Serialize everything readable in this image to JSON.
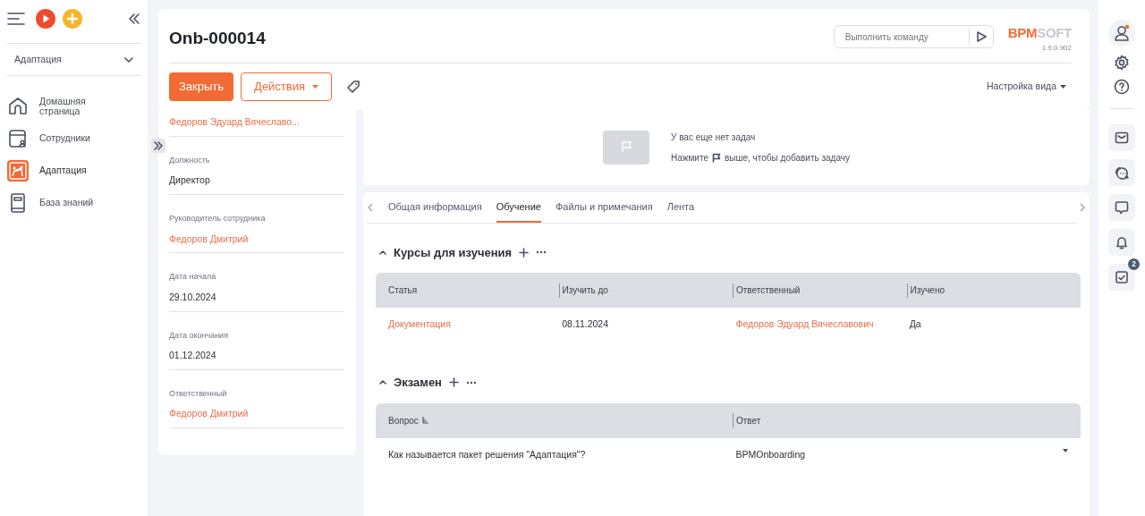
{
  "sidebar": {
    "workspace": "Адаптация",
    "items": [
      {
        "label": "Домашняя страница",
        "selected": false
      },
      {
        "label": "Сотрудники",
        "selected": false
      },
      {
        "label": "Адаптация",
        "selected": true
      },
      {
        "label": "База знаний",
        "selected": false
      }
    ]
  },
  "header": {
    "title": "Onb-000014",
    "command_placeholder": "Выполнить команду",
    "logo": {
      "accent": "BPM",
      "rest": "SOFT"
    },
    "version": "1.9.0.902"
  },
  "actions": {
    "close": "Закрыть",
    "actions": "Действия",
    "view_settings": "Настройка вида"
  },
  "fields": [
    {
      "value": "Федоров Эдуард Вячеславо...",
      "kind": "link"
    },
    {
      "label": "Должность",
      "value": "Директор",
      "kind": "text"
    },
    {
      "label": "Руководитель сотрудника",
      "value": "Федоров Дмитрий",
      "kind": "link"
    },
    {
      "label": "Дата начала",
      "value": "29.10.2024",
      "kind": "text"
    },
    {
      "label": "Дата окончания",
      "value": "01.12.2024",
      "kind": "text"
    },
    {
      "label": "Ответственный",
      "value": "Федоров Дмитрий",
      "kind": "link"
    }
  ],
  "tasks": {
    "empty": "У вас еще нет задач",
    "hint_before": "Нажмите",
    "hint_after": "выше, чтобы добавить задачу"
  },
  "tabs": [
    {
      "label": "Общая информация",
      "selected": false
    },
    {
      "label": "Обучение",
      "selected": true
    },
    {
      "label": "Файлы и примечания",
      "selected": false
    },
    {
      "label": "Лента",
      "selected": false
    }
  ],
  "sections": [
    {
      "title": "Курсы для изучения",
      "columns": [
        {
          "label": "Статья",
          "sorted": false
        },
        {
          "label": "Изучить до",
          "sorted": false
        },
        {
          "label": "Ответственный",
          "sorted": false
        },
        {
          "label": "Изучено",
          "sorted": false
        }
      ],
      "rows": [
        {
          "cells": [
            {
              "text": "Документация",
              "kind": "link"
            },
            {
              "text": "08.11.2024",
              "kind": "text"
            },
            {
              "text": "Федоров Эдуард Вячеславович",
              "kind": "link"
            },
            {
              "text": "Да",
              "kind": "text"
            }
          ],
          "dropdown": false
        }
      ]
    },
    {
      "title": "Экзамен",
      "columns": [
        {
          "label": "Вопрос",
          "sorted": true
        },
        {
          "label": "Ответ",
          "sorted": false
        }
      ],
      "rows": [
        {
          "cells": [
            {
              "text": "Как называется пакет решения \"Адаптация\"?",
              "kind": "text"
            },
            {
              "text": "BPMOnboarding",
              "kind": "text"
            }
          ],
          "dropdown": true
        }
      ]
    }
  ],
  "rail": {
    "tasks_badge": "2"
  }
}
